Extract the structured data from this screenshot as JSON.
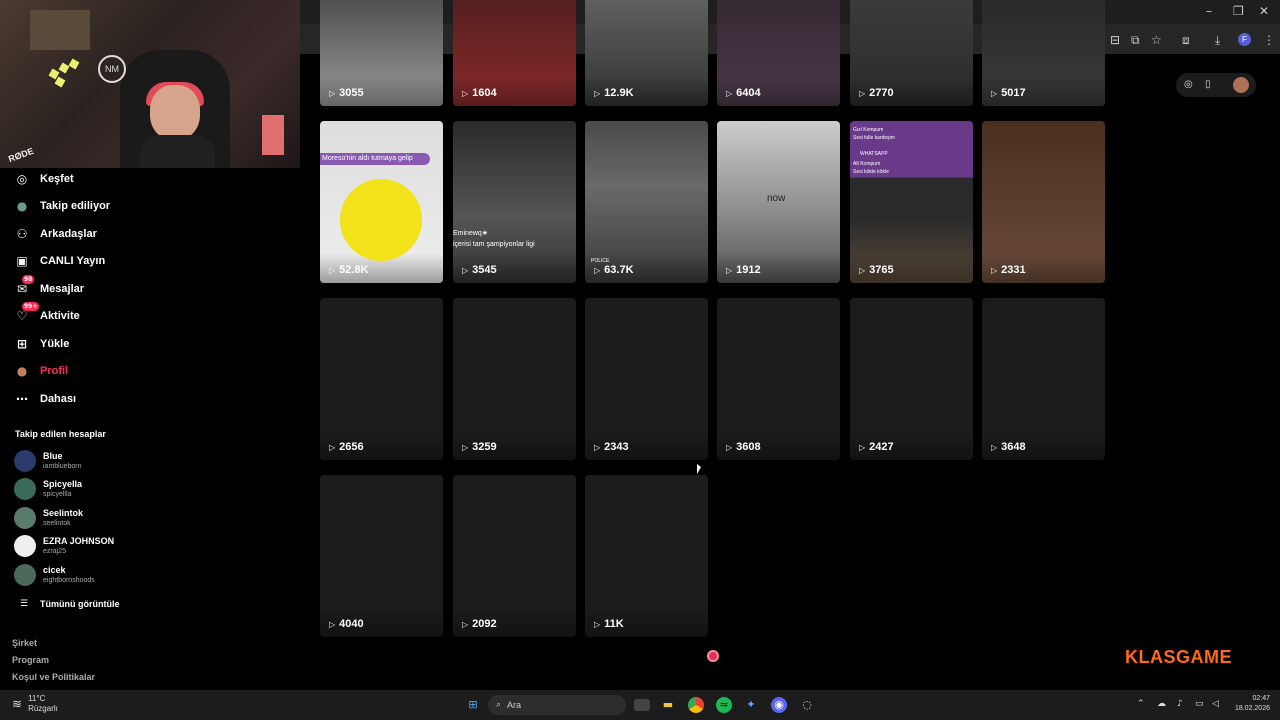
{
  "sidebar": {
    "nav": [
      {
        "label": "Keşfet",
        "icon": "compass-icon",
        "glyph": "◎"
      },
      {
        "label": "Takip ediliyor",
        "icon": "following-avatar-icon",
        "glyph": "●"
      },
      {
        "label": "Arkadaşlar",
        "icon": "friends-icon",
        "glyph": "⚇"
      },
      {
        "label": "CANLI Yayın",
        "icon": "live-tv-icon",
        "glyph": "▣"
      },
      {
        "label": "Mesajlar",
        "icon": "messages-icon",
        "glyph": "✉",
        "badge": "98"
      },
      {
        "label": "Aktivite",
        "icon": "activity-icon",
        "glyph": "♡",
        "badge": "99+"
      },
      {
        "label": "Yükle",
        "icon": "upload-icon",
        "glyph": "⊞"
      },
      {
        "label": "Profil",
        "icon": "profile-avatar-icon",
        "glyph": "●",
        "active": true
      },
      {
        "label": "Dahası",
        "icon": "more-icon",
        "glyph": "⋯"
      }
    ],
    "followed_title": "Takip edilen hesaplar",
    "followed": [
      {
        "name": "Blue",
        "handle": "iamblueborn",
        "color": "#2a3a6a"
      },
      {
        "name": "Spicyella",
        "handle": "spicyellla",
        "color": "#3a6a5a"
      },
      {
        "name": "Seelintok",
        "handle": "seelintok",
        "color": "#5a7a6a"
      },
      {
        "name": "EZRA JOHNSON",
        "handle": "ezraj25",
        "color": "#eeeeee"
      },
      {
        "name": "cicek",
        "handle": "eightbornshoods",
        "color": "#4a6a5a"
      }
    ],
    "see_all": "Tümünü görüntüle",
    "footer": [
      "Şirket",
      "Program",
      "Koşul ve Politikalar"
    ]
  },
  "grid": {
    "row0": [
      "3055",
      "1604",
      "12.9K",
      "6404",
      "2770",
      "5017"
    ],
    "row1": [
      "52.8K",
      "3545",
      "63.7K",
      "1912",
      "3765",
      "2331"
    ],
    "row2": [
      "2656",
      "3259",
      "2343",
      "3608",
      "2427",
      "3648"
    ],
    "row3": [
      "4040",
      "2092",
      "11K"
    ]
  },
  "captions": {
    "c1": "Moreso'nin aldı tutmaya gelip",
    "c2": "Eminewq★",
    "c3": "içerisi tam şampiyonlar ligi",
    "c4": "now",
    "c5": "Gızl Kompum",
    "c6": "Sesi fulle kardeşim",
    "c7": "WHATSAPP",
    "c8": "Alt Kompum",
    "c9": "Sesi kökle kökle",
    "c10": "POLICE"
  },
  "webcam": {
    "logo": "NM",
    "mic": "RØDE"
  },
  "watermark": "KLASGAME",
  "taskbar": {
    "weather_temp": "11°C",
    "weather_text": "Rüzgarlı",
    "search": "Ara",
    "time": "02:47",
    "date": "18.02.2026"
  },
  "colors": {
    "accent": "#fe2c55",
    "watermark": "#ff6a1a"
  }
}
